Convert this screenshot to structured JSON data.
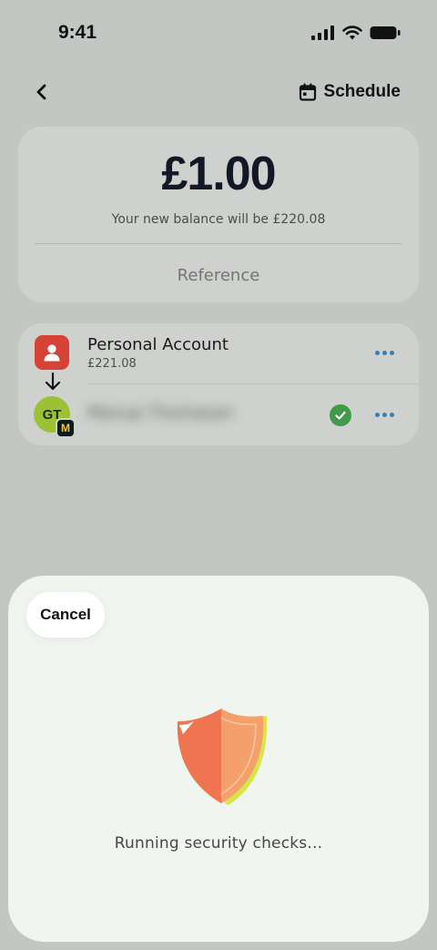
{
  "status_bar": {
    "time": "9:41"
  },
  "nav": {
    "schedule_label": "Schedule"
  },
  "amount": {
    "value": "£1.00",
    "balance_note": "Your new balance will be £220.08",
    "reference_placeholder": "Reference"
  },
  "accounts": {
    "from": {
      "name": "Personal Account",
      "balance": "£221.08"
    },
    "to": {
      "initials": "GT",
      "bank_initial": "M",
      "name_blurred": "Manup Thomason"
    }
  },
  "sheet": {
    "cancel_label": "Cancel",
    "status_text": "Running security checks..."
  },
  "colors": {
    "backdrop": "#c3c7c3",
    "accent_blue": "#3f7cb5",
    "personal_red": "#d64336",
    "payee_green": "#9cc134",
    "verified_green": "#3f9a4a",
    "shield_orange": "#ee7b52"
  }
}
